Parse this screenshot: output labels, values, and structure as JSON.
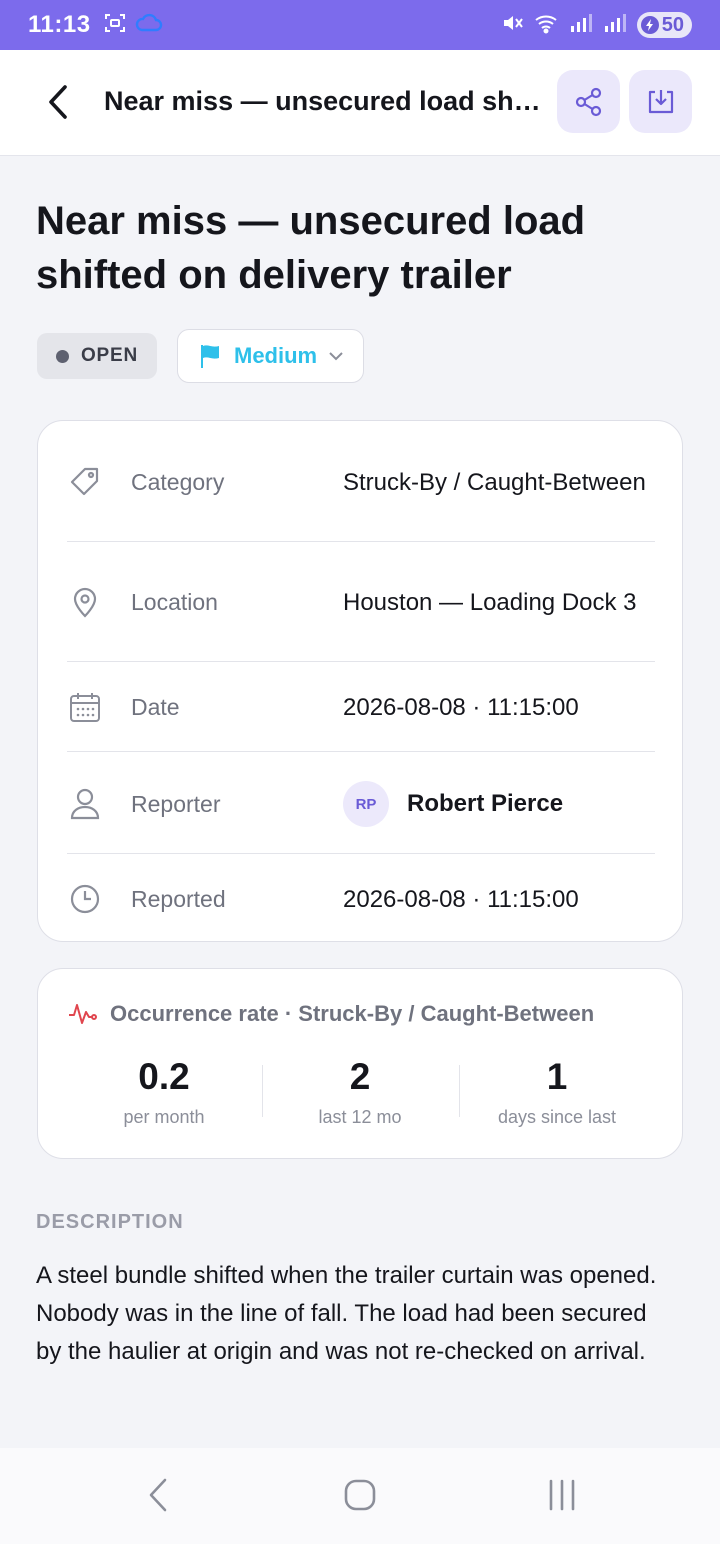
{
  "status_bar": {
    "time": "11:13",
    "battery": "50"
  },
  "header": {
    "title": "Near miss — unsecured load shifted on delivery trailer"
  },
  "incident": {
    "title": "Near miss — unsecured load shifted on delivery trailer",
    "status": "OPEN",
    "priority": "Medium",
    "priority_color": "#2ec0ea"
  },
  "details": {
    "category_label": "Category",
    "category_value": "Struck-By / Caught-Between",
    "location_label": "Location",
    "location_value": "Houston — Loading Dock 3",
    "date_label": "Date",
    "date_value": "2026-08-08 · 11:15:00",
    "reporter_label": "Reporter",
    "reporter_initials": "RP",
    "reporter_name": "Robert Pierce",
    "reported_label": "Reported",
    "reported_value": "2026-08-08 · 11:15:00"
  },
  "occurrence": {
    "heading": "Occurrence rate · Struck-By / Caught-Between",
    "stats": [
      {
        "value": "0.2",
        "label": "per month"
      },
      {
        "value": "2",
        "label": "last 12 mo"
      },
      {
        "value": "1",
        "label": "days since last"
      }
    ]
  },
  "description": {
    "heading": "DESCRIPTION",
    "text": "A steel bundle shifted when the trailer curtain was opened. Nobody was in the line of fall. The load had been secured by the haulier at origin and was not re-checked on arrival."
  },
  "colors": {
    "accent": "#7c6bec",
    "status_bar": "#7c6bec",
    "pulse_icon": "#e0464e"
  }
}
